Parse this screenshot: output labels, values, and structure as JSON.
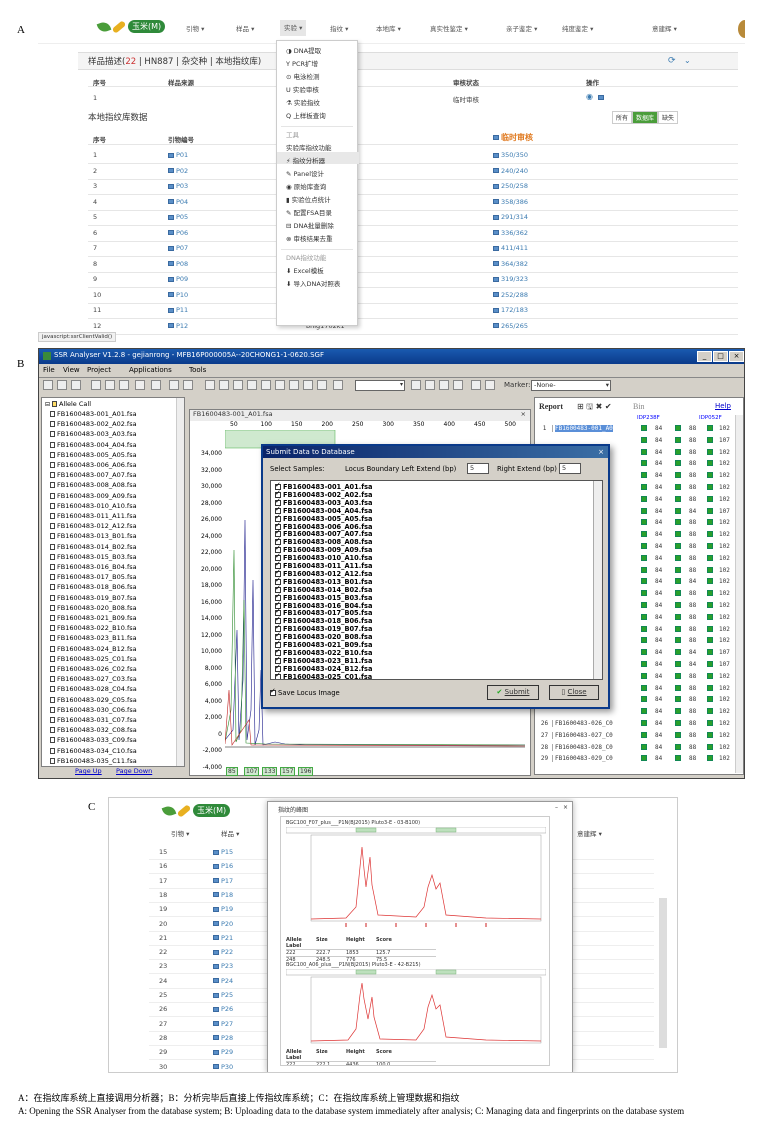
{
  "panel_labels": {
    "a": "A",
    "b": "B",
    "c": "C"
  },
  "panelA": {
    "logo_badge": "玉米(M)",
    "nav": [
      {
        "label": "引物 ▾"
      },
      {
        "label": "样品 ▾"
      },
      {
        "label": "实验 ▾"
      },
      {
        "label": "指纹 ▾"
      },
      {
        "label": "本地库 ▾"
      },
      {
        "label": "真实性鉴定 ▾"
      },
      {
        "label": "亲子鉴定 ▾"
      },
      {
        "label": "纯度鉴定 ▾"
      },
      {
        "label": "意建辉 ▾"
      }
    ],
    "sample_title_prefix": "样品描述(",
    "sample_count": "22",
    "sample_title_rest": " | HN887 | 杂交种 | 本地指纹库)",
    "sample_headers": [
      "序号",
      "样品来源",
      "审核状态",
      "操作"
    ],
    "sample_row": {
      "no": "1",
      "status": "临时审核"
    },
    "local_title": "本地指纹库数据",
    "filters": [
      "所有",
      "数据库",
      "缺失"
    ],
    "table_headers": [
      "序号",
      "引物编号",
      "临时审核"
    ],
    "rows": [
      {
        "no": "1",
        "id": "P01",
        "v": "350/350"
      },
      {
        "no": "2",
        "id": "P02",
        "v": "240/240"
      },
      {
        "no": "3",
        "id": "P03",
        "v": "250/258"
      },
      {
        "no": "4",
        "id": "P04",
        "v": "358/386"
      },
      {
        "no": "5",
        "id": "P05",
        "v": "291/314"
      },
      {
        "no": "6",
        "id": "P06",
        "v": "336/362"
      },
      {
        "no": "7",
        "id": "P07",
        "v": "411/411"
      },
      {
        "no": "8",
        "id": "P08",
        "v": "364/382"
      },
      {
        "no": "9",
        "id": "P09",
        "v": "319/323"
      },
      {
        "no": "10",
        "id": "P10",
        "v": "252/288"
      },
      {
        "no": "11",
        "id": "P11",
        "m": "bnlg161k9",
        "v": "172/183"
      },
      {
        "no": "12",
        "id": "P12",
        "m": "bnlg1702k1",
        "v": "265/265"
      }
    ],
    "menu": [
      "DNA提取",
      "PCR扩增",
      "电泳检测",
      "实验审核",
      "实验指纹",
      "上样板查询"
    ],
    "menu_tools_group": "工具",
    "menu_tools": [
      "实验库指纹功能",
      "指纹分析器",
      "Panel设计",
      "原始库查询",
      "实验位点统计",
      "配置FSA目录",
      "DNA批量删除",
      "审核结果去重"
    ],
    "menu_dna_group": "DNA指纹功能",
    "menu_dna": [
      "Excel模板",
      "导入DNA对照表"
    ],
    "status_bar": "javascript:ssrClientValid()"
  },
  "panelB": {
    "title": "SSR Analyser V1.2.8 - gejianrong - MFB16P000005A--20CHONG1-1-0620.SGF",
    "menu": [
      "File",
      "View",
      "Project",
      "Applications",
      "Tools"
    ],
    "marker_label": "Marker:",
    "marker_value": "-None-",
    "tree_root": "Allele Call",
    "tree_items": [
      "FB1600483-001_A01.fsa",
      "FB1600483-002_A02.fsa",
      "FB1600483-003_A03.fsa",
      "FB1600483-004_A04.fsa",
      "FB1600483-005_A05.fsa",
      "FB1600483-006_A06.fsa",
      "FB1600483-007_A07.fsa",
      "FB1600483-008_A08.fsa",
      "FB1600483-009_A09.fsa",
      "FB1600483-010_A10.fsa",
      "FB1600483-011_A11.fsa",
      "FB1600483-012_A12.fsa",
      "FB1600483-013_B01.fsa",
      "FB1600483-014_B02.fsa",
      "FB1600483-015_B03.fsa",
      "FB1600483-016_B04.fsa",
      "FB1600483-017_B05.fsa",
      "FB1600483-018_B06.fsa",
      "FB1600483-019_B07.fsa",
      "FB1600483-020_B08.fsa",
      "FB1600483-021_B09.fsa",
      "FB1600483-022_B10.fsa",
      "FB1600483-023_B11.fsa",
      "FB1600483-024_B12.fsa",
      "FB1600483-025_C01.fsa",
      "FB1600483-026_C02.fsa",
      "FB1600483-027_C03.fsa",
      "FB1600483-028_C04.fsa",
      "FB1600483-029_C05.fsa",
      "FB1600483-030_C06.fsa",
      "FB1600483-031_C07.fsa",
      "FB1600483-032_C08.fsa",
      "FB1600483-033_C09.fsa",
      "FB1600483-034_C10.fsa",
      "FB1600483-035_C11.fsa"
    ],
    "page_up": "Page Up",
    "page_down": "Page Down",
    "plot_title": "FB1600483-001_A01.fsa",
    "x_ticks": [
      "50",
      "100",
      "150",
      "200",
      "250",
      "300",
      "350",
      "400",
      "450",
      "500"
    ],
    "y_ticks": [
      "34,000",
      "32,000",
      "30,000",
      "28,000",
      "26,000",
      "24,000",
      "22,000",
      "20,000",
      "18,000",
      "16,000",
      "14,000",
      "12,000",
      "10,000",
      "8,000",
      "6,000",
      "4,000",
      "2,000",
      "0",
      "-2,000",
      "-4,000"
    ],
    "bin_labels": [
      "85",
      "107",
      "133",
      "157",
      "196"
    ],
    "dialog": {
      "title": "Submit Data to Database",
      "select": "Select Samples:",
      "left_label": "Locus Boundary Left Extend (bp)",
      "left_val": "5",
      "right_label": "Right Extend (bp)",
      "right_val": "5",
      "samples": [
        "FB1600483-001_A01.fsa",
        "FB1600483-002_A02.fsa",
        "FB1600483-003_A03.fsa",
        "FB1600483-004_A04.fsa",
        "FB1600483-005_A05.fsa",
        "FB1600483-006_A06.fsa",
        "FB1600483-007_A07.fsa",
        "FB1600483-008_A08.fsa",
        "FB1600483-009_A09.fsa",
        "FB1600483-010_A10.fsa",
        "FB1600483-011_A11.fsa",
        "FB1600483-012_A12.fsa",
        "FB1600483-013_B01.fsa",
        "FB1600483-014_B02.fsa",
        "FB1600483-015_B03.fsa",
        "FB1600483-016_B04.fsa",
        "FB1600483-017_B05.fsa",
        "FB1600483-018_B06.fsa",
        "FB1600483-019_B07.fsa",
        "FB1600483-020_B08.fsa",
        "FB1600483-021_B09.fsa",
        "FB1600483-022_B10.fsa",
        "FB1600483-023_B11.fsa",
        "FB1600483-024_B12.fsa",
        "FB1600483-025_C01.fsa"
      ],
      "save_image": "Save Locus Image",
      "submit": "Submit",
      "close": "Close"
    },
    "report": {
      "title": "Report",
      "bin": "Bin",
      "help": "Help",
      "cols": [
        "IDP238F",
        "IDP052F"
      ],
      "rows": [
        {
          "n": "1",
          "s": "FB1600483-001_A0",
          "a": "84",
          "b": "88",
          "c": "102"
        },
        {
          "n": "",
          "s": "",
          "a": "84",
          "b": "88",
          "c": "107"
        },
        {
          "n": "",
          "s": "",
          "a": "84",
          "b": "88",
          "c": "102"
        },
        {
          "n": "",
          "s": "",
          "a": "84",
          "b": "88",
          "c": "102"
        },
        {
          "n": "",
          "s": "",
          "a": "84",
          "b": "88",
          "c": "102"
        },
        {
          "n": "",
          "s": "",
          "a": "84",
          "b": "88",
          "c": "102"
        },
        {
          "n": "",
          "s": "",
          "a": "84",
          "b": "88",
          "c": "102"
        },
        {
          "n": "",
          "s": "",
          "a": "84",
          "b": "84",
          "c": "107"
        },
        {
          "n": "",
          "s": "",
          "a": "84",
          "b": "88",
          "c": "102"
        },
        {
          "n": "",
          "s": "",
          "a": "84",
          "b": "88",
          "c": "102"
        },
        {
          "n": "",
          "s": "",
          "a": "84",
          "b": "88",
          "c": "102"
        },
        {
          "n": "",
          "s": "",
          "a": "84",
          "b": "88",
          "c": "102"
        },
        {
          "n": "",
          "s": "",
          "a": "84",
          "b": "88",
          "c": "102"
        },
        {
          "n": "",
          "s": "",
          "a": "84",
          "b": "84",
          "c": "102"
        },
        {
          "n": "",
          "s": "",
          "a": "84",
          "b": "88",
          "c": "102"
        },
        {
          "n": "",
          "s": "",
          "a": "84",
          "b": "88",
          "c": "102"
        },
        {
          "n": "",
          "s": "",
          "a": "84",
          "b": "88",
          "c": "102"
        },
        {
          "n": "",
          "s": "",
          "a": "84",
          "b": "88",
          "c": "102"
        },
        {
          "n": "",
          "s": "",
          "a": "84",
          "b": "88",
          "c": "102"
        },
        {
          "n": "",
          "s": "",
          "a": "84",
          "b": "84",
          "c": "107"
        },
        {
          "n": "",
          "s": "",
          "a": "84",
          "b": "84",
          "c": "107"
        },
        {
          "n": "",
          "s": "",
          "a": "84",
          "b": "88",
          "c": "102"
        },
        {
          "n": "",
          "s": "",
          "a": "84",
          "b": "88",
          "c": "102"
        },
        {
          "n": "",
          "s": "",
          "a": "84",
          "b": "88",
          "c": "102"
        },
        {
          "n": "",
          "s": "",
          "a": "84",
          "b": "88",
          "c": "102"
        },
        {
          "n": "26",
          "s": "FB1600483-026_C0",
          "a": "84",
          "b": "88",
          "c": "102"
        },
        {
          "n": "27",
          "s": "FB1600483-027_C0",
          "a": "84",
          "b": "88",
          "c": "102"
        },
        {
          "n": "28",
          "s": "FB1600483-028_C0",
          "a": "84",
          "b": "88",
          "c": "102"
        },
        {
          "n": "29",
          "s": "FB1600483-029_C0",
          "a": "84",
          "b": "88",
          "c": "102"
        }
      ]
    }
  },
  "panelC": {
    "nav": [
      "引物 ▾",
      "样品 ▾",
      "意建辉 ▾"
    ],
    "rows": [
      {
        "no": "15",
        "id": "P15"
      },
      {
        "no": "16",
        "id": "P16"
      },
      {
        "no": "17",
        "id": "P17"
      },
      {
        "no": "18",
        "id": "P18"
      },
      {
        "no": "19",
        "id": "P19"
      },
      {
        "no": "20",
        "id": "P20"
      },
      {
        "no": "21",
        "id": "P21"
      },
      {
        "no": "22",
        "id": "P22"
      },
      {
        "no": "23",
        "id": "P23"
      },
      {
        "no": "24",
        "id": "P24"
      },
      {
        "no": "25",
        "id": "P25"
      },
      {
        "no": "26",
        "id": "P26"
      },
      {
        "no": "27",
        "id": "P27"
      },
      {
        "no": "28",
        "id": "P28"
      },
      {
        "no": "29",
        "id": "P29"
      },
      {
        "no": "30",
        "id": "P30"
      }
    ],
    "popup_title": "指纹的峰图",
    "trace1": {
      "title": "BGC100_F07_plus___P1N(BJ2015) Pluto3-E - 03-B100)",
      "table": {
        "headers": [
          "Allele Label",
          "Size",
          "Height",
          "Score"
        ],
        "rows": [
          [
            "222",
            "222.7",
            "1853",
            "125.7"
          ],
          [
            "248",
            "248.5",
            "776",
            "75.5"
          ]
        ]
      }
    },
    "trace2": {
      "title": "BGC100_A06_plus___P1N(BJ2015) Pluto3-E - 42-B215)",
      "table": {
        "headers": [
          "Allele Label",
          "Size",
          "Height",
          "Score"
        ],
        "rows": [
          [
            "222",
            "222.1",
            "4436",
            "100.0"
          ],
          [
            "248",
            "248.8",
            "2966",
            "100.0"
          ]
        ]
      }
    }
  },
  "captions": {
    "zh": "A：在指纹库系统上直接调用分析器；B：分析完毕后直接上传指纹库系统；C：在指纹库系统上管理数据和指纹",
    "en": "A: Opening the SSR Analyser from the database system; B: Uploading data to the database system immediately after analysis; C: Managing data and fingerprints on the database system"
  }
}
